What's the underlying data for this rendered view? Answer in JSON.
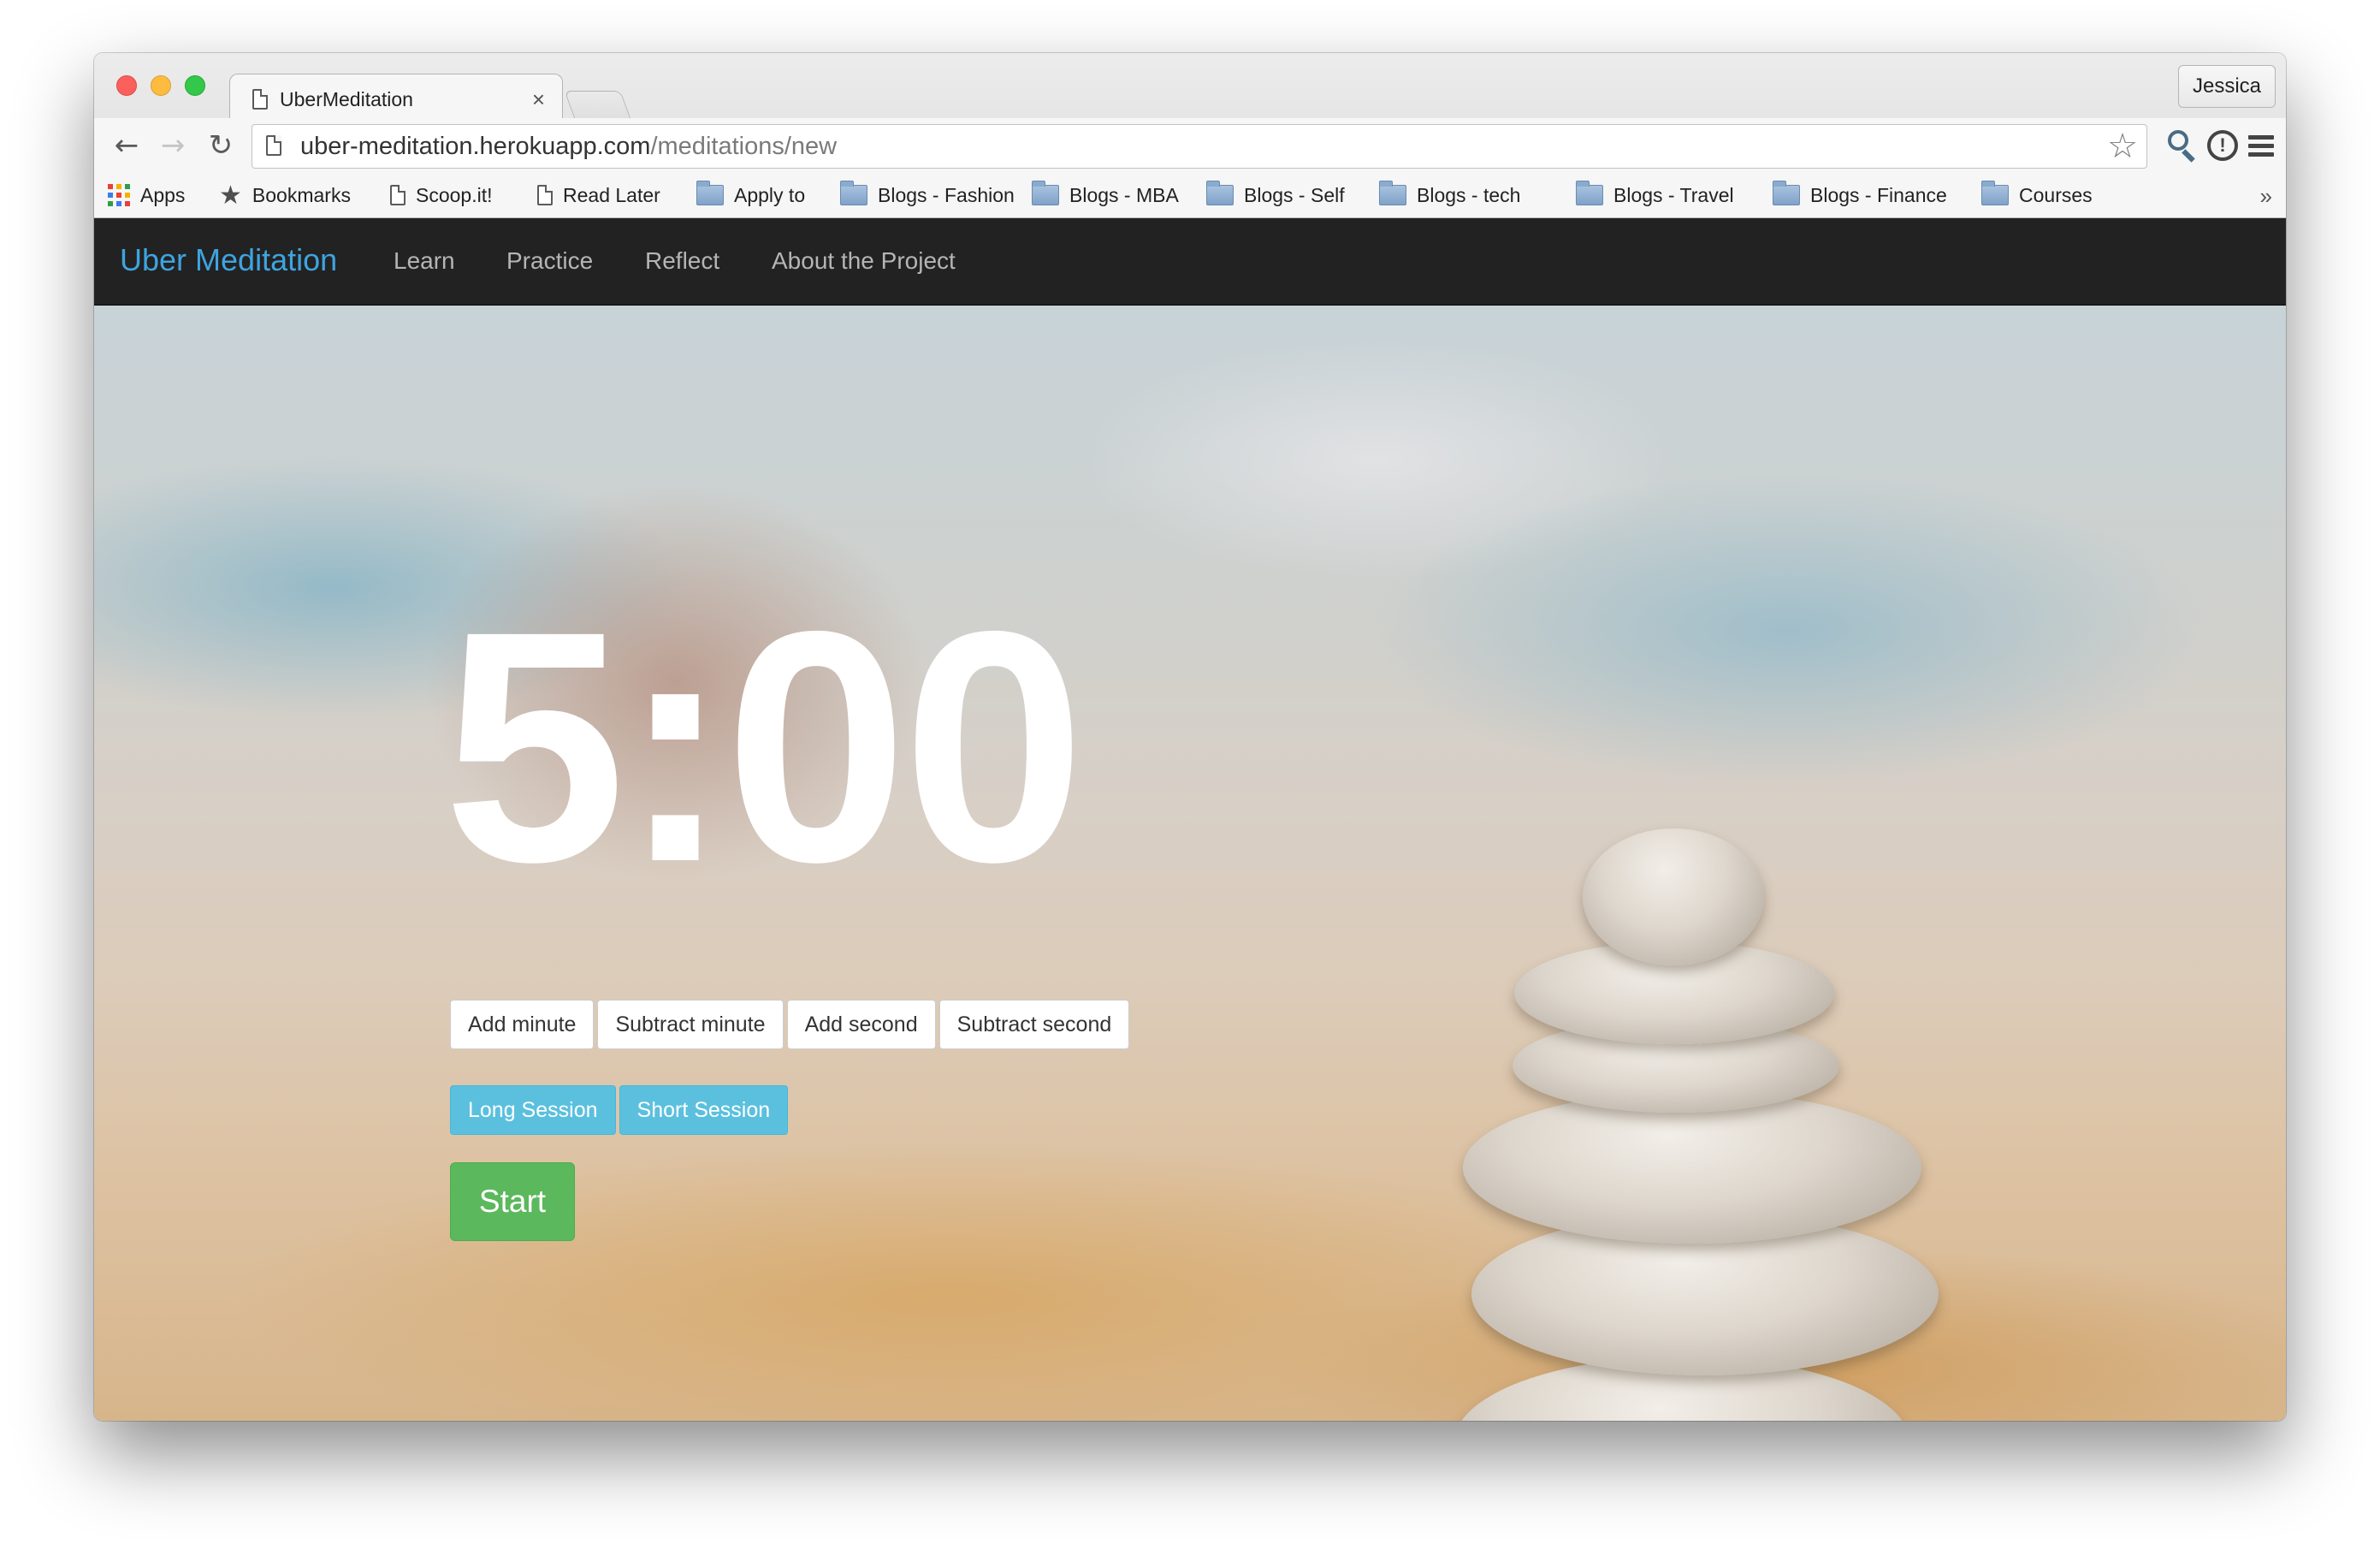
{
  "browser": {
    "tab_title": "UberMeditation",
    "tab_close": "×",
    "profile_name": "Jessica",
    "url_host": "uber-meditation.herokuapp.com",
    "url_path": "/meditations/new",
    "bookmarks": [
      {
        "label": "Apps",
        "icon": "apps-grid-icon"
      },
      {
        "label": "Bookmarks",
        "icon": "star-icon"
      },
      {
        "label": "Scoop.it!",
        "icon": "page-icon"
      },
      {
        "label": "Read Later",
        "icon": "page-icon"
      },
      {
        "label": "Apply to",
        "icon": "folder-icon"
      },
      {
        "label": "Blogs - Fashion",
        "icon": "folder-icon"
      },
      {
        "label": "Blogs - MBA",
        "icon": "folder-icon"
      },
      {
        "label": "Blogs - Self",
        "icon": "folder-icon"
      },
      {
        "label": "Blogs - tech",
        "icon": "folder-icon"
      },
      {
        "label": "Blogs - Travel",
        "icon": "folder-icon"
      },
      {
        "label": "Blogs - Finance",
        "icon": "folder-icon"
      },
      {
        "label": "Courses",
        "icon": "folder-icon"
      }
    ],
    "bookmarks_overflow": "»"
  },
  "navbar": {
    "brand": "Uber Meditation",
    "links": [
      "Learn",
      "Practice",
      "Reflect",
      "About the Project"
    ]
  },
  "timer": {
    "display": "5:00"
  },
  "controls": {
    "adjust_buttons": [
      "Add minute",
      "Subtract minute",
      "Add second",
      "Subtract second"
    ],
    "session_buttons": [
      "Long Session",
      "Short Session"
    ],
    "start_label": "Start"
  },
  "colors": {
    "brand": "#3ea4e0",
    "navbar_bg": "#222222",
    "info_button": "#5bc0de",
    "success_button": "#5cb85c"
  }
}
